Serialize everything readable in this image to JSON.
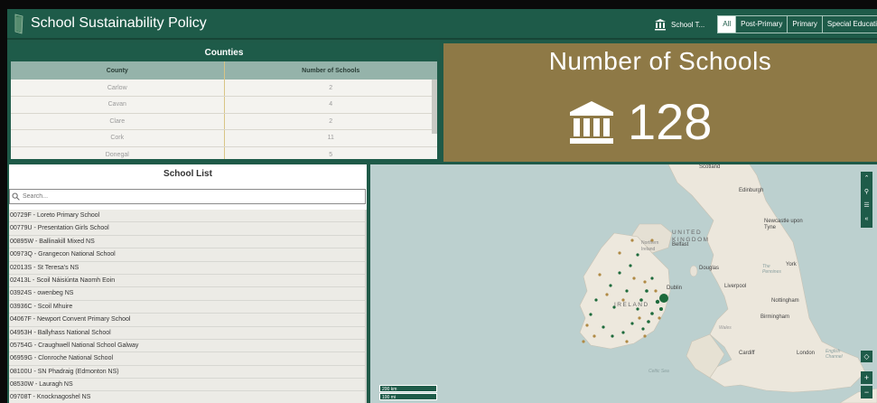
{
  "header": {
    "title": "School Sustainability Policy",
    "filter_label": "School T...",
    "filters": [
      "All",
      "Post-Primary",
      "Primary",
      "Special Education"
    ],
    "active_filter": "All"
  },
  "counties": {
    "title": "Counties",
    "columns": [
      "County",
      "Number of Schools"
    ],
    "rows": [
      {
        "county": "Carlow",
        "count": "2"
      },
      {
        "county": "Cavan",
        "count": "4"
      },
      {
        "county": "Clare",
        "count": "2"
      },
      {
        "county": "Cork",
        "count": "11"
      },
      {
        "county": "Donegal",
        "count": "5"
      }
    ]
  },
  "stat": {
    "title": "Number of Schools",
    "value": "128",
    "icon": "building-columns-icon"
  },
  "school_list": {
    "title": "School List",
    "search_placeholder": "Search...",
    "items": [
      "00729F - Loreto Primary School",
      "00779U - Presentation Girls School",
      "00895W - Ballinakill Mixed NS",
      "00973Q - Grangecon National School",
      "02013S - St Teresa's NS",
      "02413L - Scoil Náisiúnta Naomh Eoin",
      "03924S - owenbeg NS",
      "03936C - Scoil Mhuire",
      "04067F - Newport Convent Primary School",
      "04953H - Ballyhass National School",
      "05754G - Craughwell National School Galway",
      "06959G - Clonroche National School",
      "08100U - SN Phadraig (Edmonton NS)",
      "08530W - Lauragh NS",
      "09708T - Knocknagoshel NS"
    ]
  },
  "map": {
    "labels": {
      "scotland": "Scotland",
      "edinburgh": "Edinburgh",
      "newcastle": "Newcastle upon Tyne",
      "united_kingdom": "UNITED KINGDOM",
      "northern_ireland": "Northern Ireland",
      "belfast": "Belfast",
      "douglas": "Douglas",
      "york": "York",
      "pennines": "The Pennines",
      "dublin": "Dublin",
      "liverpool": "Liverpool",
      "ireland": "IRELAND",
      "nottingham": "Nottingham",
      "birmingham": "Birmingham",
      "wales": "Wales",
      "cardiff": "Cardiff",
      "london": "London",
      "english_channel": "English Channel",
      "celtic_sea": "Celtic Sea"
    },
    "scale": [
      "200 km",
      "100 mi"
    ],
    "colors": {
      "school_green": "#1e6b3c",
      "school_tan": "#b08a45",
      "accent": "#1e5b49"
    }
  }
}
